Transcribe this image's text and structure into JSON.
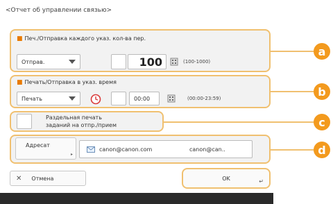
{
  "header": {
    "title": "<Отчет об управлении связью>"
  },
  "section_a": {
    "label": "Печ./Отправка каждого указ. кол-ва пер.",
    "dropdown_value": "Отправ.",
    "number_value": "100",
    "range": "(100-1000)",
    "marker": "a"
  },
  "section_b": {
    "label": "Печать/Отправка в указ. время",
    "dropdown_value": "Печать",
    "time_value": "00:00",
    "range": "(00:00-23:59)",
    "marker": "b"
  },
  "section_c": {
    "label_line1": "Раздельная печать",
    "label_line2": "заданий на отпр./прием",
    "marker": "c"
  },
  "section_d": {
    "button_label": "Адресат",
    "address_left": "canon@canon.com",
    "address_right": "canon@can..",
    "marker": "d"
  },
  "footer": {
    "cancel_label": "Отмена",
    "ok_label": "OK"
  },
  "colors": {
    "accent": "#f39a1e",
    "highlight_border": "#f0c070"
  }
}
